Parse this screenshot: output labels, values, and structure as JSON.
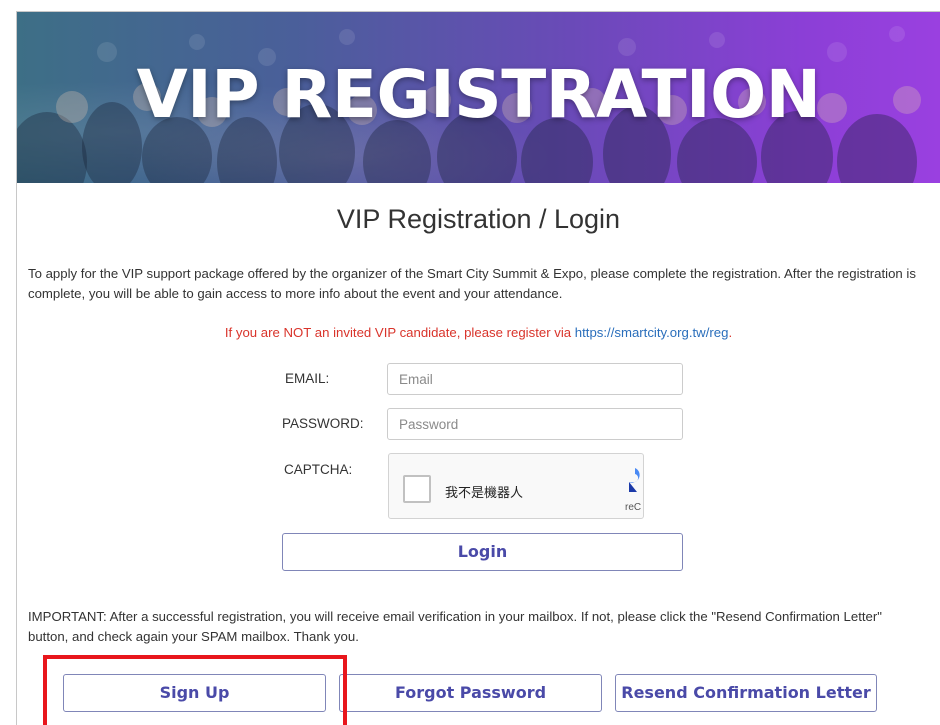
{
  "banner": {
    "title": "VIP REGISTRATION"
  },
  "page": {
    "title": "VIP Registration / Login",
    "intro": "To apply for the VIP support package offered by the organizer of the Smart City Summit & Expo, please complete the registration. After the registration is complete, you will be able to gain access to more info about the event and your attendance.",
    "notice_text": "If you are NOT an invited VIP candidate, please register via ",
    "notice_link": "https://smartcity.org.tw/reg",
    "notice_end": "."
  },
  "form": {
    "email_label": "EMAIL:",
    "email_placeholder": "Email",
    "email_value": "",
    "password_label": "PASSWORD:",
    "password_placeholder": "Password",
    "password_value": "",
    "captcha_label": "CAPTCHA:",
    "captcha_text": "我不是機器人",
    "captcha_brand": "reC",
    "login_label": "Login"
  },
  "important": "IMPORTANT: After a successful registration, you will receive email verification in your mailbox. If not, please click the \"Resend Confirmation Letter\" button, and check again your SPAM mailbox. Thank you.",
  "actions": {
    "signup_label": "Sign Up",
    "forgot_label": "Forgot Password",
    "resend_label": "Resend Confirmation Letter"
  },
  "colors": {
    "accent": "#4a4aa8",
    "notice": "#d9342b",
    "link": "#2a6ebb",
    "highlight": "#e8161c"
  }
}
